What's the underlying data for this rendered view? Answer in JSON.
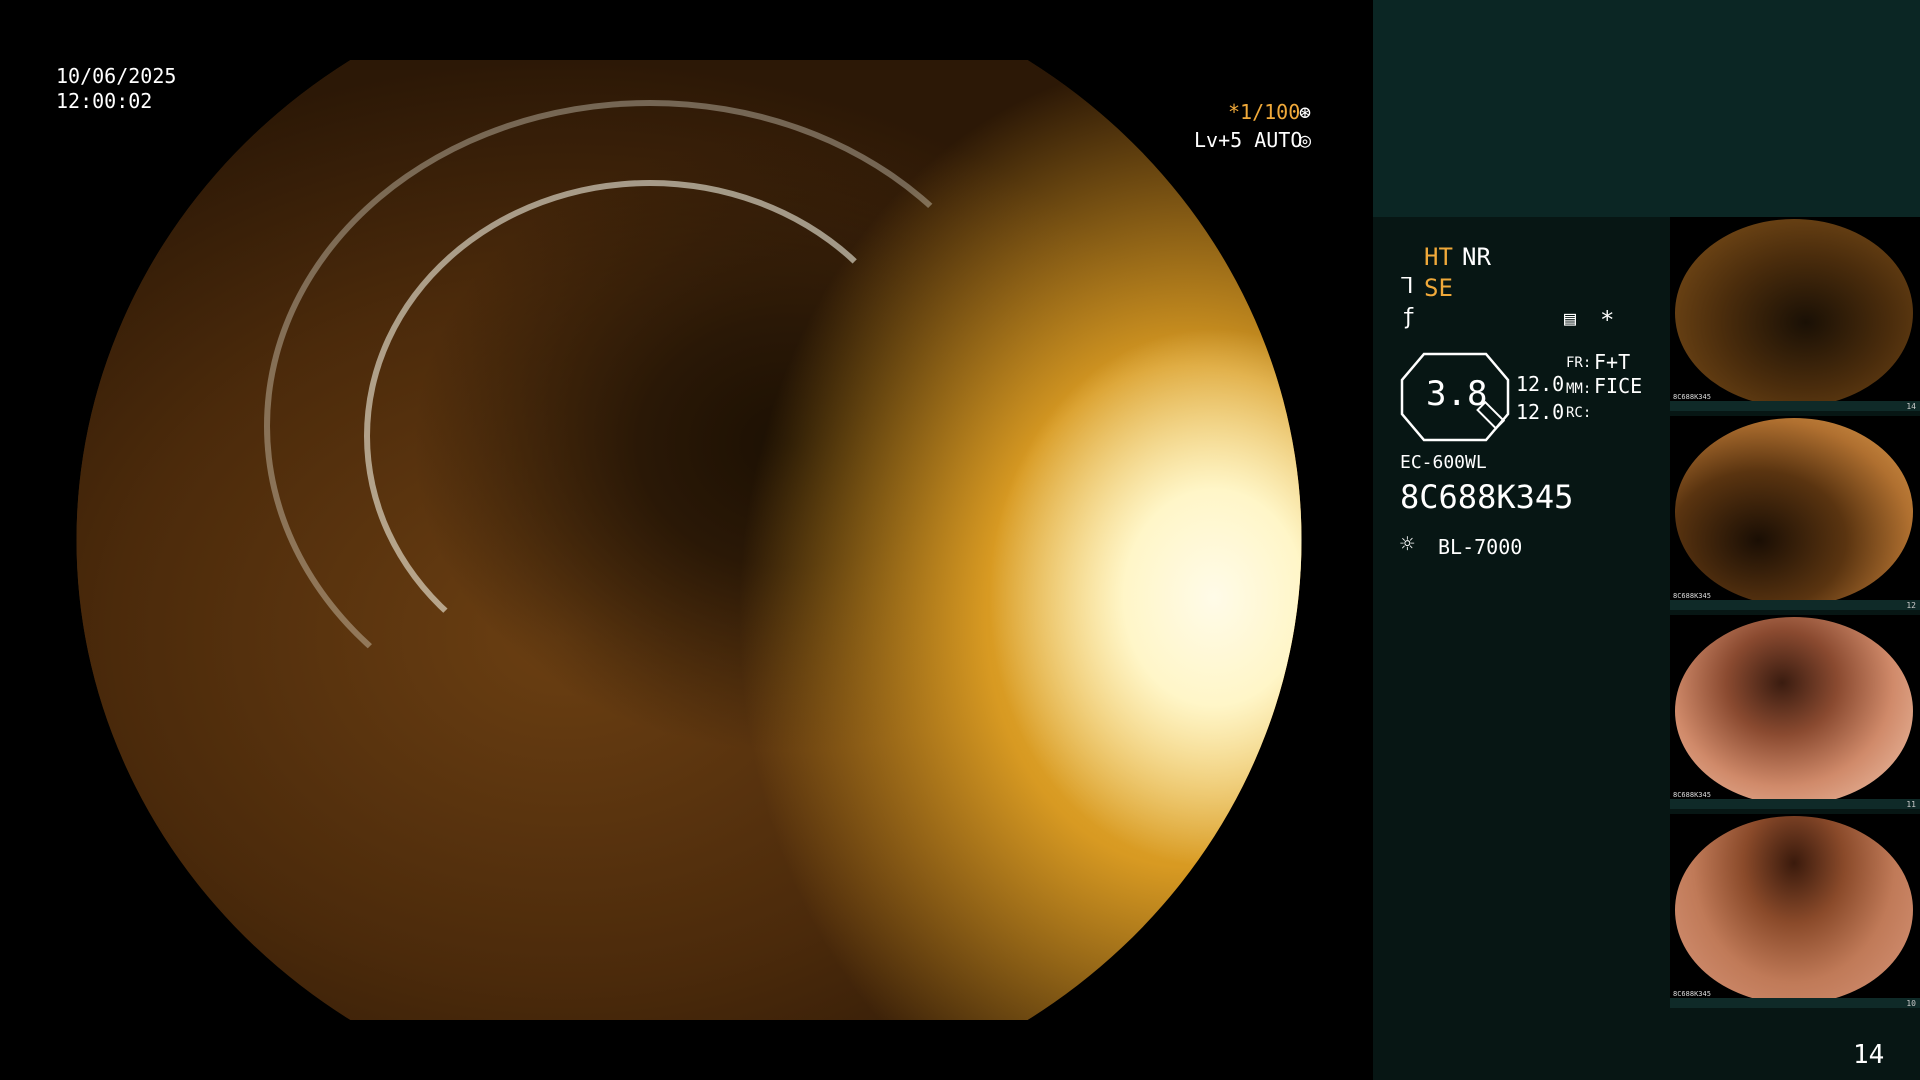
{
  "overlay": {
    "date": "10/06/2025",
    "time": "12:00:02",
    "shutter": "*1/100",
    "level": "Lv+5 AUTO",
    "shutter_icon": "aperture-icon",
    "auto_icon": "auto-iris-icon"
  },
  "panel": {
    "ht_label": "HT",
    "nr_label": "NR",
    "se_label": "SE",
    "se_icon": "scope-icon",
    "f_icon": "f-symbol-icon",
    "menu_icon": "settings-list-icon",
    "star_label": "*",
    "zoom_value": "3.8",
    "val_a": "12.0",
    "val_b": "12.0",
    "fr_label": "FR:",
    "fr_value": "F+T",
    "mm_label": "MM:",
    "mm_value": "FICE",
    "rc_label": "RC:",
    "scope_model": "EC-600WL",
    "serial": "8C688K345",
    "light_source": "BL-7000",
    "light_icon": "light-source-icon"
  },
  "thumbnails": [
    {
      "number": "14",
      "caption": "8C688K345"
    },
    {
      "number": "12",
      "caption": "8C688K345"
    },
    {
      "number": "11",
      "caption": "8C688K345"
    },
    {
      "number": "10",
      "caption": "8C688K345"
    }
  ],
  "page_number": "14",
  "colors": {
    "accent_orange": "#f0a93a",
    "panel_bg": "#071614",
    "panel_top": "#0b2624"
  }
}
